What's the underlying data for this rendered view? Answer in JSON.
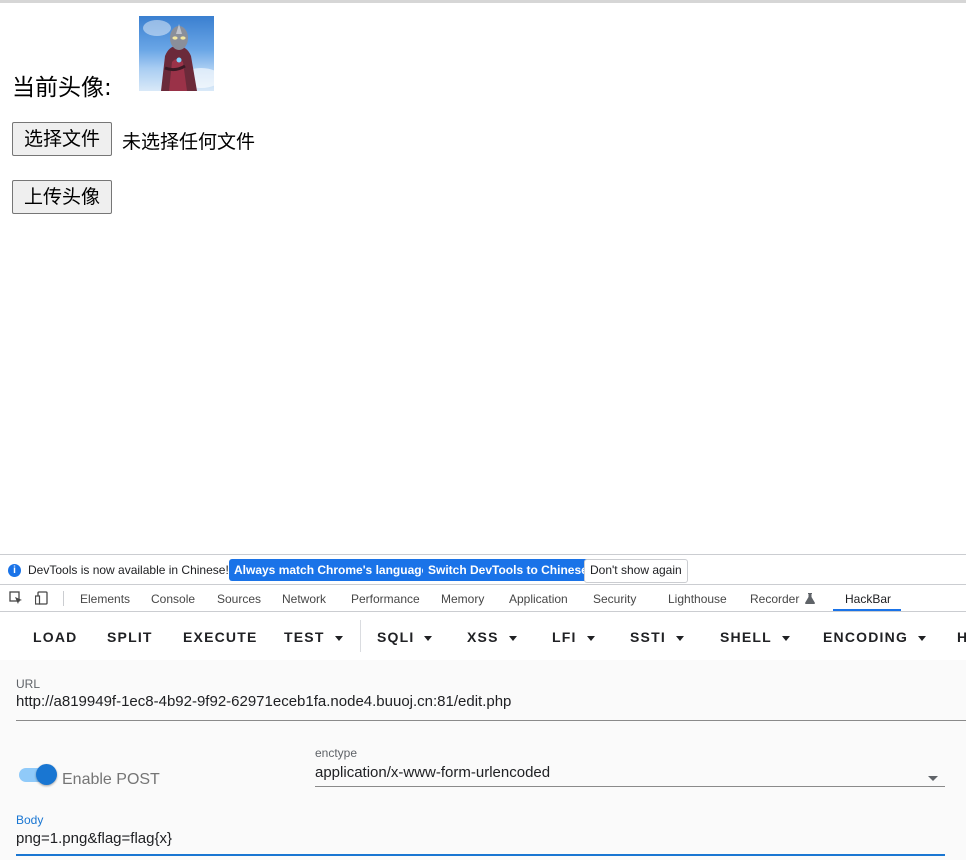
{
  "page": {
    "avatar_label": "当前头像:",
    "avatar_alt": "avatar",
    "choose_file_button": "选择文件",
    "file_status": "未选择任何文件",
    "upload_button": "上传头像"
  },
  "devtools": {
    "infobar": {
      "message": "DevTools is now available in Chinese!",
      "match_language_button": "Always match Chrome's language",
      "switch_button": "Switch DevTools to Chinese",
      "dismiss_button": "Don't show again"
    },
    "tabs": [
      "Elements",
      "Console",
      "Sources",
      "Network",
      "Performance",
      "Memory",
      "Application",
      "Security",
      "Lighthouse",
      "Recorder",
      "HackBar"
    ],
    "active_tab": "HackBar"
  },
  "hackbar": {
    "toolbar": [
      "LOAD",
      "SPLIT",
      "EXECUTE",
      "TEST",
      "SQLI",
      "XSS",
      "LFI",
      "SSTI",
      "SHELL",
      "ENCODING",
      "H"
    ],
    "url_label": "URL",
    "url_value": "http://a819949f-1ec8-4b92-9f92-62971eceb1fa.node4.buuoj.cn:81/edit.php",
    "enable_post_label": "Enable POST",
    "enable_post": true,
    "enctype_label": "enctype",
    "enctype_value": "application/x-www-form-urlencoded",
    "body_label": "Body",
    "body_value": "png=1.png&flag=flag{x}"
  },
  "colors": {
    "accent": "#1a73e8",
    "toggle": "#1976d2",
    "body_label": "#1976d2"
  }
}
